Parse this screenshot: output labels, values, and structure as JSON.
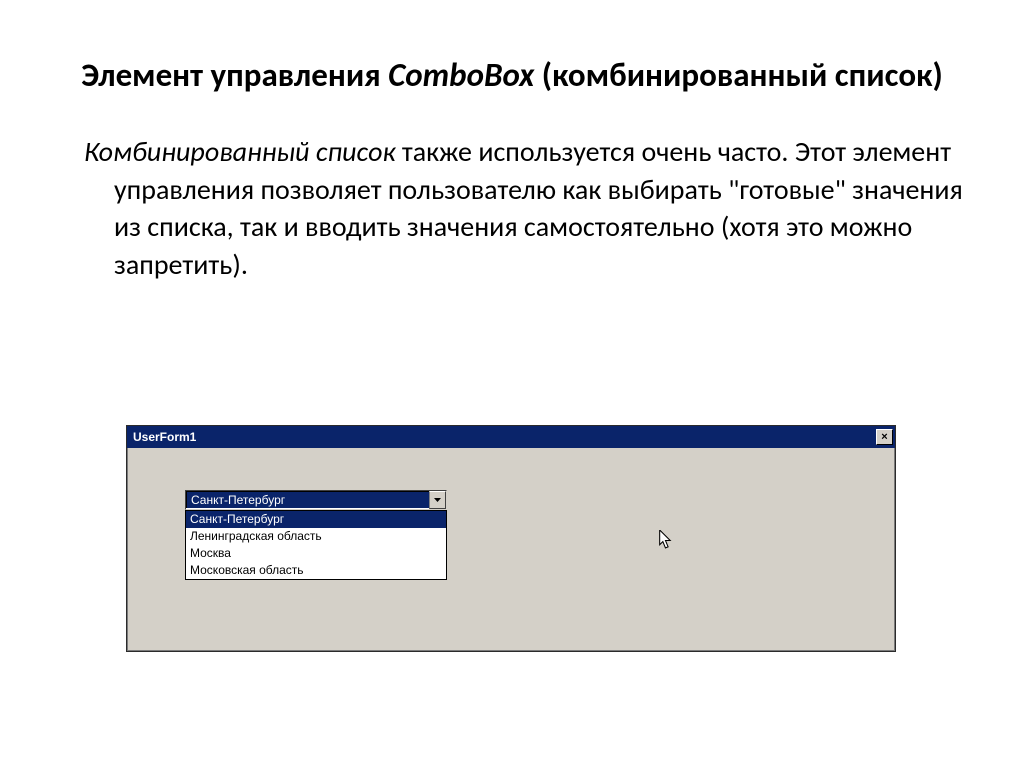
{
  "title_part1": "Элемент управления ",
  "title_italic": "ComboBox",
  "title_part2": " (комбинированный список)",
  "body_italic": "Комбинированный список",
  "body_rest": " также используется очень часто. Этот элемент управления позволяет пользователю как выбирать \"готовые\" значения из списка, так и вводить значения самостоятельно (хотя это можно запретить).",
  "window": {
    "title": "UserForm1",
    "close_glyph": "×"
  },
  "combo": {
    "selected": "Санкт-Петербург",
    "options": [
      "Санкт-Петербург",
      "Ленинградская область",
      "Москва",
      "Московская область"
    ],
    "selected_index": 0
  }
}
